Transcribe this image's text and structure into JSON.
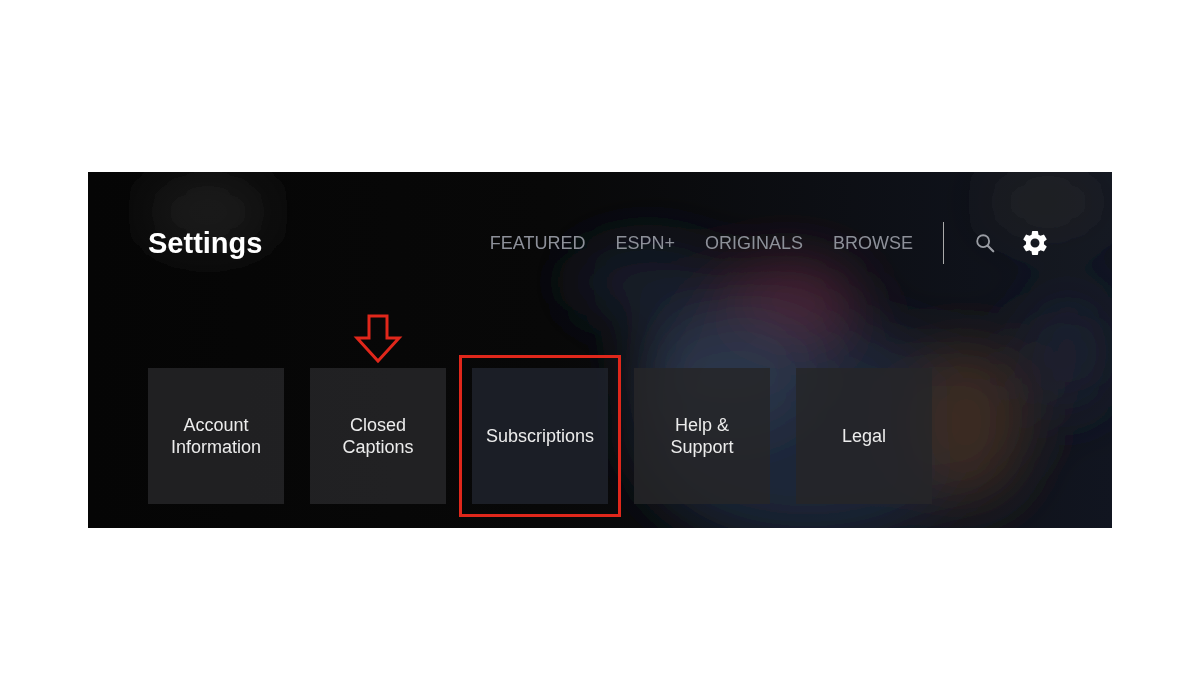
{
  "page_title": "Settings",
  "nav": [
    {
      "label": "FEATURED",
      "selected": false
    },
    {
      "label": "ESPN+",
      "selected": false
    },
    {
      "label": "ORIGINALS",
      "selected": false
    },
    {
      "label": "BROWSE",
      "selected": false
    }
  ],
  "icons": [
    {
      "kind": "search",
      "selected": false
    },
    {
      "kind": "settings",
      "selected": true
    }
  ],
  "tiles": [
    {
      "lines": [
        "Account",
        "Information"
      ],
      "arrow": false,
      "highlighted": false
    },
    {
      "lines": [
        "Closed",
        "Captions"
      ],
      "arrow": true,
      "highlighted": false
    },
    {
      "lines": [
        "Subscriptions"
      ],
      "arrow": false,
      "highlighted": true
    },
    {
      "lines": [
        "Help &",
        "Support"
      ],
      "arrow": false,
      "highlighted": false
    },
    {
      "lines": [
        "Legal"
      ],
      "arrow": false,
      "highlighted": false
    }
  ]
}
